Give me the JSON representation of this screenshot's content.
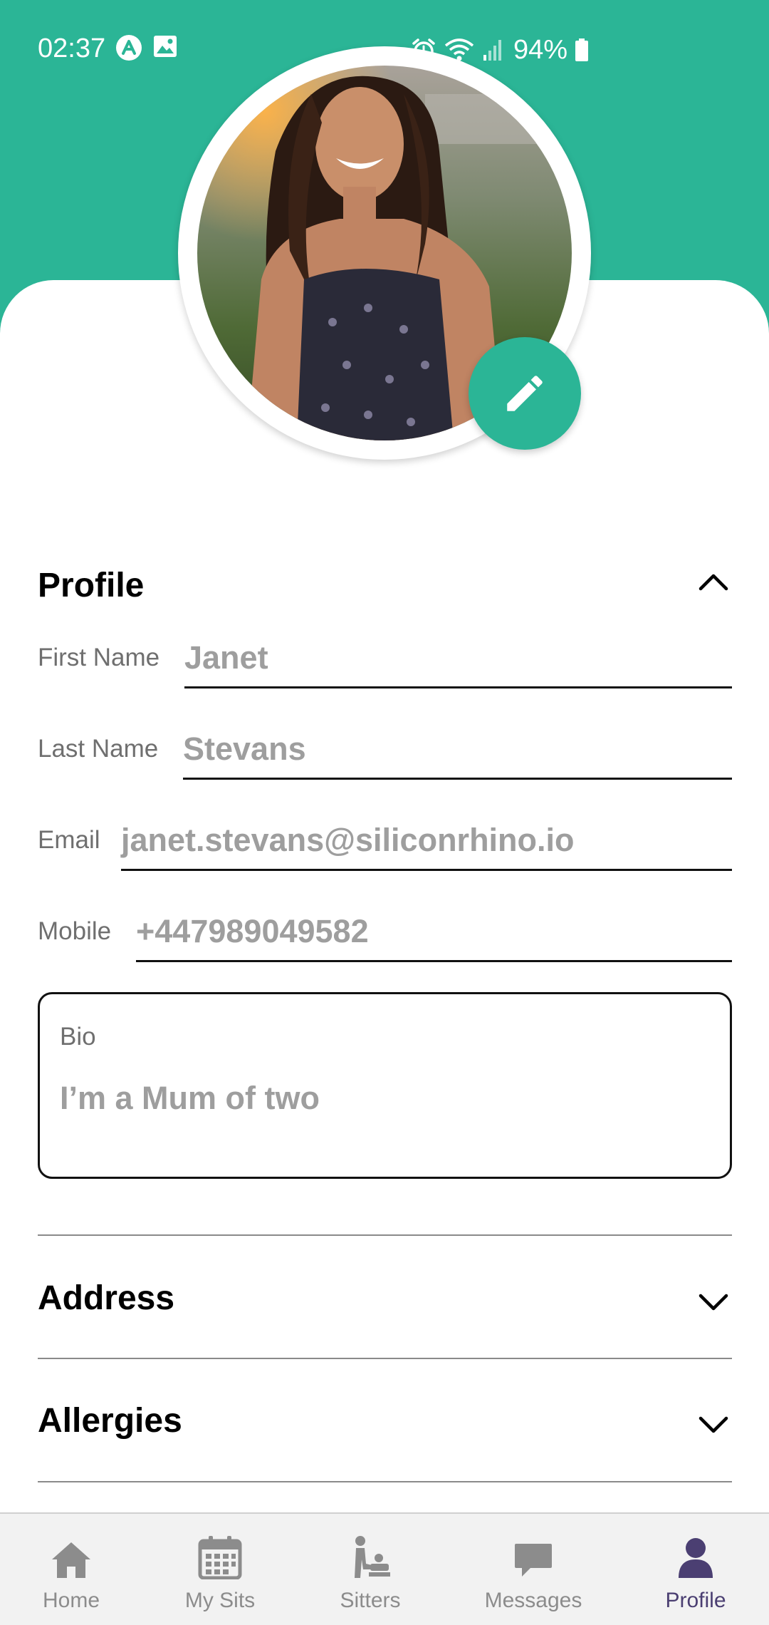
{
  "status_bar": {
    "time": "02:37",
    "battery": "94%"
  },
  "profile_section": {
    "title": "Profile",
    "fields": {
      "first_name": {
        "label": "First Name",
        "value": "Janet"
      },
      "last_name": {
        "label": "Last Name",
        "value": "Stevans"
      },
      "email": {
        "label": "Email",
        "value": "janet.stevans@siliconrhino.io"
      },
      "mobile": {
        "label": "Mobile",
        "value": "+447989049582"
      }
    },
    "bio": {
      "label": "Bio",
      "value": "I’m a Mum of two"
    }
  },
  "sections": {
    "address": "Address",
    "allergies": "Allergies"
  },
  "bottom_nav": {
    "home": "Home",
    "my_sits": "My Sits",
    "sitters": "Sitters",
    "messages": "Messages",
    "profile": "Profile"
  },
  "colors": {
    "primary": "#2bb596",
    "active_nav": "#4b3f72",
    "inactive_nav": "#8c8c8c"
  }
}
